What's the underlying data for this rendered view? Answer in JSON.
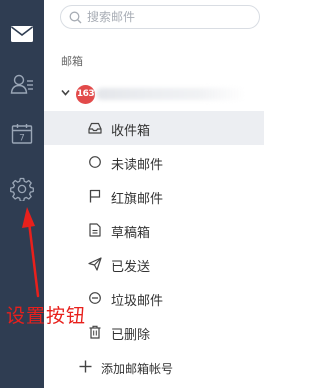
{
  "search": {
    "placeholder": "搜索邮件"
  },
  "mailbox": {
    "section_label": "邮箱",
    "account_badge": "163",
    "folders": [
      {
        "label": "收件箱",
        "icon": "inbox-icon",
        "active": true
      },
      {
        "label": "未读邮件",
        "icon": "circle-icon"
      },
      {
        "label": "红旗邮件",
        "icon": "flag-icon"
      },
      {
        "label": "草稿箱",
        "icon": "draft-icon"
      },
      {
        "label": "已发送",
        "icon": "send-icon"
      },
      {
        "label": "垃圾邮件",
        "icon": "spam-icon"
      },
      {
        "label": "已删除",
        "icon": "trash-icon"
      }
    ],
    "add_account_label": "添加邮箱帐号"
  },
  "rail": {
    "items": [
      "mail-icon",
      "contacts-icon",
      "calendar-icon",
      "settings-icon"
    ],
    "calendar_day": "7"
  },
  "annotation": {
    "text": "设置按钮",
    "color": "#e8201c"
  },
  "colors": {
    "rail_bg": "#2f3d52",
    "active_row": "#eceef2",
    "badge": "#e24a4a"
  }
}
